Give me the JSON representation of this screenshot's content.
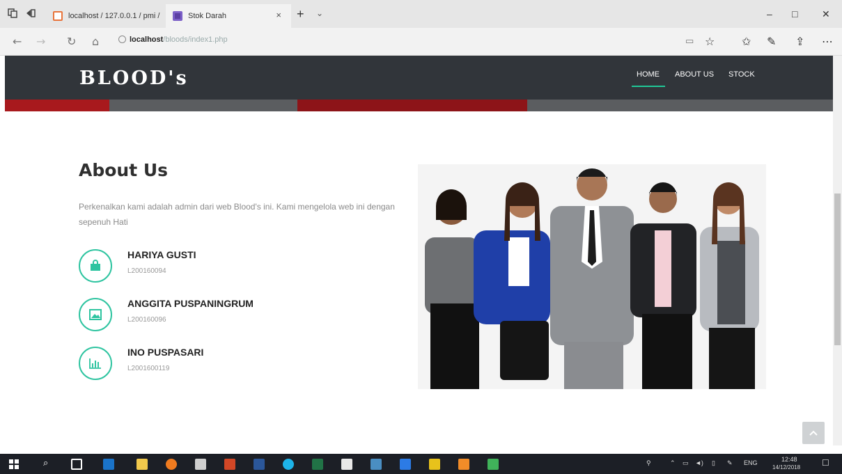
{
  "browser": {
    "tabs": [
      {
        "label": "localhost / 127.0.0.1 / pmi /",
        "active": false
      },
      {
        "label": "Stok Darah",
        "active": true
      }
    ],
    "close_symbol": "×",
    "newtab_symbol": "+",
    "url_host": "localhost",
    "url_path": "/bloods/index1.php",
    "window_controls": [
      "–",
      "□",
      "✕"
    ]
  },
  "site": {
    "logo": "BLOOD's",
    "nav": [
      "HOME",
      "ABOUT US",
      "STOCK"
    ],
    "active_nav": "HOME",
    "accent_color": "#2ec4a0"
  },
  "about": {
    "title": "About Us",
    "description": "Perkenalkan kami adalah admin dari web Blood's ini. Kami mengelola web ini dengan sepenuh Hati",
    "members": [
      {
        "name": "HARIYA GUSTI",
        "id": "L200160094",
        "icon": "bag-icon"
      },
      {
        "name": "ANGGITA PUSPANINGRUM",
        "id": "L200160096",
        "icon": "image-icon"
      },
      {
        "name": "INO PUSPASARI",
        "id": "L2001600119",
        "icon": "chart-icon"
      }
    ],
    "photo": "team-photo"
  },
  "taskbar": {
    "lang": "ENG",
    "time": "12:48",
    "date": "14/12/2018"
  }
}
